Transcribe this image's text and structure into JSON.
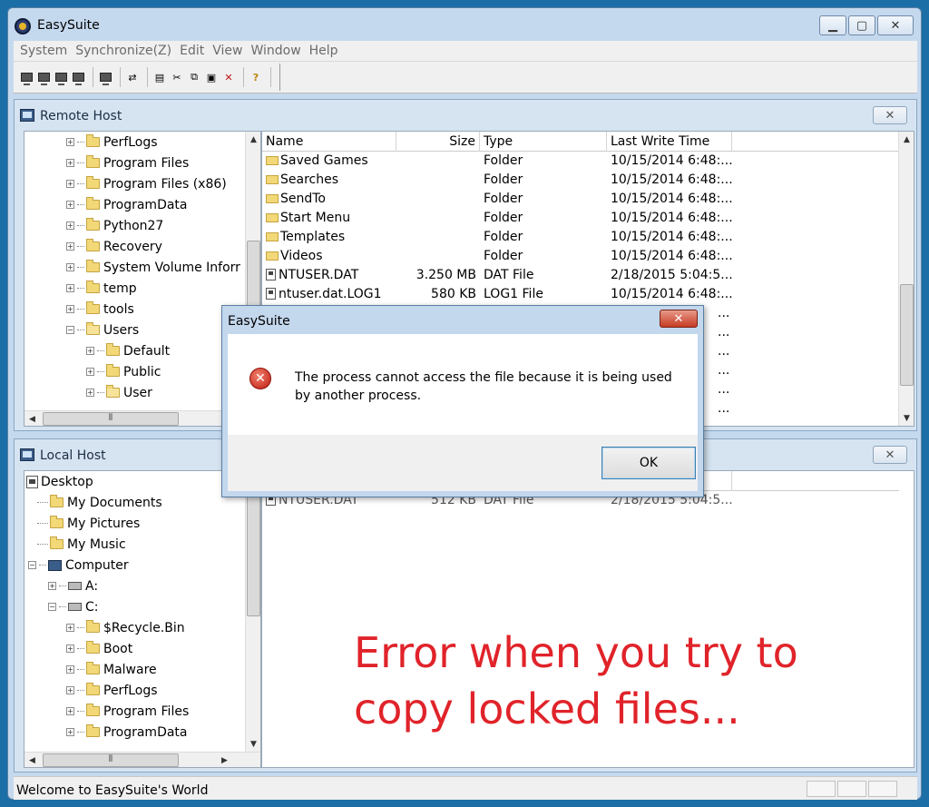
{
  "window": {
    "title": "EasySuite"
  },
  "menu": [
    "System",
    "Synchronize(Z)",
    "Edit",
    "View",
    "Window",
    "Help"
  ],
  "toolbar": {
    "icons": [
      "connect-icon",
      "disconnect-icon",
      "host-icon",
      "host-alt-icon",
      "refresh-icon",
      "sync-icon",
      "new-icon",
      "cut-icon",
      "copy-icon",
      "paste-icon",
      "delete-icon",
      "help-icon"
    ]
  },
  "remote": {
    "title": "Remote Host",
    "tree": [
      {
        "label": "PerfLogs",
        "level": 2
      },
      {
        "label": "Program Files",
        "level": 2
      },
      {
        "label": "Program Files (x86)",
        "level": 2
      },
      {
        "label": "ProgramData",
        "level": 2
      },
      {
        "label": "Python27",
        "level": 2
      },
      {
        "label": "Recovery",
        "level": 2
      },
      {
        "label": "System Volume Inforr",
        "level": 2
      },
      {
        "label": "temp",
        "level": 2
      },
      {
        "label": "tools",
        "level": 2
      },
      {
        "label": "Users",
        "level": 2
      },
      {
        "label": "Default",
        "level": 3
      },
      {
        "label": "Public",
        "level": 3
      },
      {
        "label": "User",
        "level": 3
      }
    ],
    "columns": [
      "Name",
      "Size",
      "Type",
      "Last Write Time"
    ],
    "rows": [
      {
        "name": "Saved Games",
        "size": "",
        "type": "Folder",
        "time": "10/15/2014 6:48:..."
      },
      {
        "name": "Searches",
        "size": "",
        "type": "Folder",
        "time": "10/15/2014 6:48:..."
      },
      {
        "name": "SendTo",
        "size": "",
        "type": "Folder",
        "time": "10/15/2014 6:48:..."
      },
      {
        "name": "Start Menu",
        "size": "",
        "type": "Folder",
        "time": "10/15/2014 6:48:..."
      },
      {
        "name": "Templates",
        "size": "",
        "type": "Folder",
        "time": "10/15/2014 6:48:..."
      },
      {
        "name": "Videos",
        "size": "",
        "type": "Folder",
        "time": "10/15/2014 6:48:..."
      },
      {
        "name": "NTUSER.DAT",
        "size": "3.250 MB",
        "type": "DAT File",
        "time": "2/18/2015 5:04:5..."
      },
      {
        "name": "ntuser.dat.LOG1",
        "size": "580 KB",
        "type": "LOG1 File",
        "time": "10/15/2014 6:48:..."
      }
    ],
    "hidden_time_fragments": [
      "...",
      "...",
      "...",
      "...",
      "...",
      "..."
    ]
  },
  "local": {
    "title": "Local Host",
    "tree": [
      {
        "label": "Desktop",
        "level": 0
      },
      {
        "label": "My Documents",
        "level": 1
      },
      {
        "label": "My Pictures",
        "level": 1
      },
      {
        "label": "My Music",
        "level": 1
      },
      {
        "label": "Computer",
        "level": 1
      },
      {
        "label": "A:",
        "level": 2
      },
      {
        "label": "C:",
        "level": 2
      },
      {
        "label": "$Recycle.Bin",
        "level": 3
      },
      {
        "label": "Boot",
        "level": 3
      },
      {
        "label": "Malware",
        "level": 3
      },
      {
        "label": "PerfLogs",
        "level": 3
      },
      {
        "label": "Program Files",
        "level": 3
      },
      {
        "label": "ProgramData",
        "level": 3
      }
    ],
    "partial_row": {
      "name": "NTUSER.DAT",
      "size": "512 KB",
      "type": "DAT File",
      "time": "2/18/2015 5:04:5..."
    }
  },
  "dialog": {
    "title": "EasySuite",
    "message": "The process cannot access the file because it is being used by another process.",
    "ok_label": "OK"
  },
  "annotation": "Error when you try to copy locked files...",
  "status": {
    "text": "Welcome to EasySuite's World"
  },
  "colors": {
    "desktop": "#1b6fa6",
    "annotation": "#e0232a",
    "window_frame": "#c5d9ee"
  }
}
